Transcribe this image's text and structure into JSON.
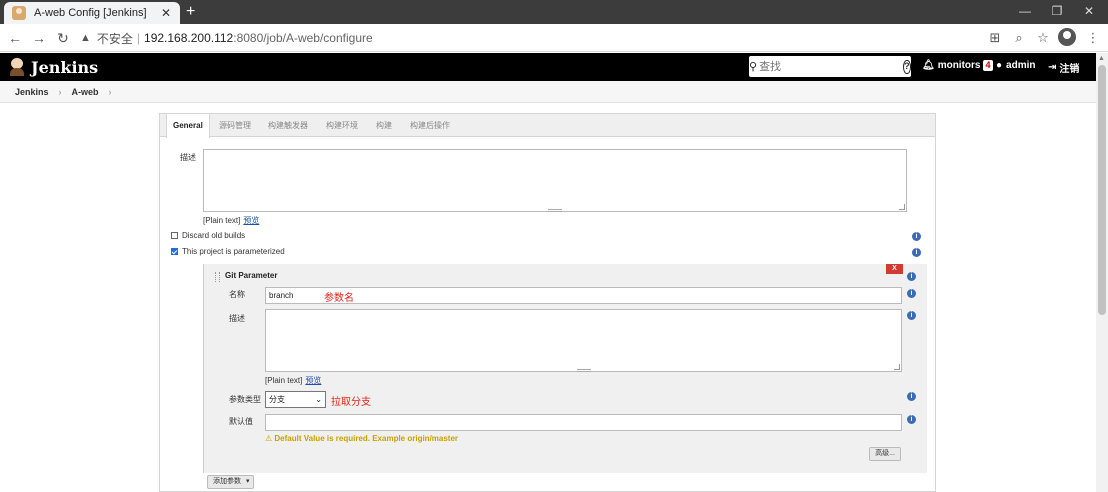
{
  "browser": {
    "tab_title": "A-web Config [Jenkins]",
    "tab_close": "✕",
    "new_tab": "+",
    "insecure_label": "不安全",
    "url_host": "192.168.200.112",
    "url_path": ":8080/job/A-web/configure",
    "window_controls": [
      "—",
      "❐",
      "✕"
    ]
  },
  "header": {
    "title": "Jenkins",
    "search_placeholder": "查找",
    "help": "?",
    "monitors_label": "monitors",
    "monitors_count": "4",
    "user": "admin",
    "logout": "注销"
  },
  "breadcrumb": [
    "Jenkins",
    "A-web"
  ],
  "tabs": [
    "General",
    "源码管理",
    "构建触发器",
    "构建环境",
    "构建",
    "构建后操作"
  ],
  "general": {
    "description_label": "描述",
    "plain_text": "[Plain text]",
    "preview": "预览",
    "discard_old_builds": "Discard old builds",
    "discard_checked": false,
    "parameterized": "This project is parameterized",
    "parameterized_checked": true
  },
  "git_parameter": {
    "title": "Git Parameter",
    "delete": "X",
    "name_label": "名称",
    "name_value": "branch",
    "name_annotation": "参数名",
    "description_label": "描述",
    "plain_text": "[Plain text]",
    "preview": "预览",
    "type_label": "参数类型",
    "type_value": "分支",
    "type_annotation": "拉取分支",
    "default_label": "默认值",
    "default_value": "",
    "warning": "Default Value is required. Example origin/master",
    "advanced": "高级..."
  },
  "add_parameter": "添加参数"
}
